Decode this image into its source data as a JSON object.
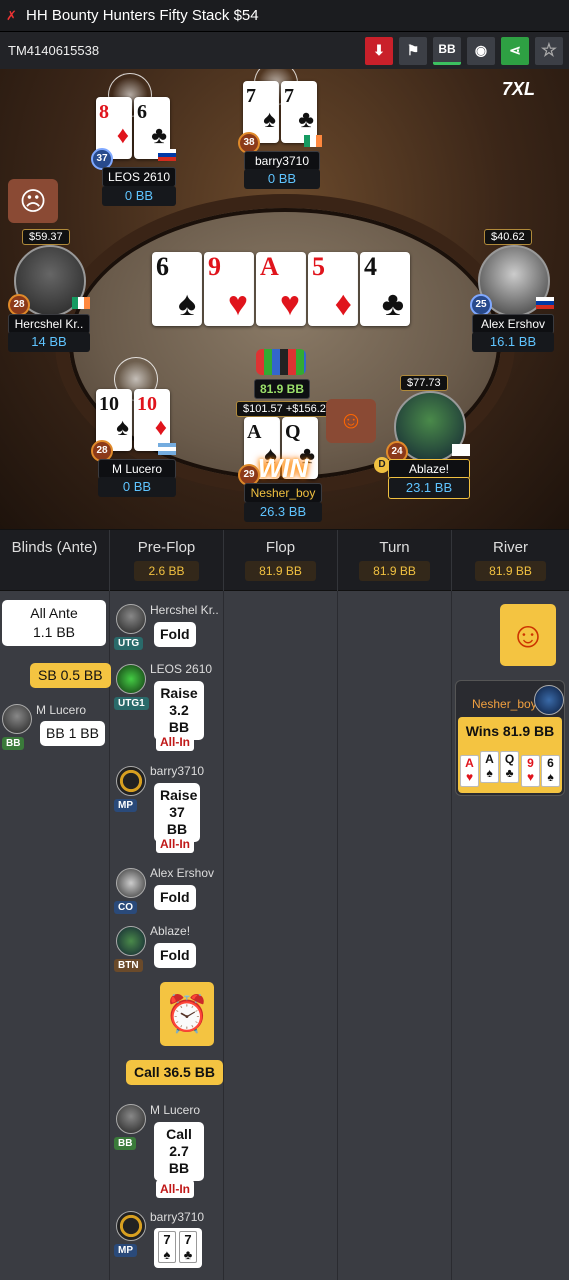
{
  "title": "HH  Bounty Hunters Fifty Stack $54",
  "hand_id": "TM4140615538",
  "toolbar": {
    "bb_label": "BB"
  },
  "board": [
    {
      "rank": "6",
      "suit": "♠",
      "color": "black"
    },
    {
      "rank": "9",
      "suit": "♥",
      "color": "red"
    },
    {
      "rank": "A",
      "suit": "♥",
      "color": "red"
    },
    {
      "rank": "5",
      "suit": "♦",
      "color": "red"
    },
    {
      "rank": "4",
      "suit": "♣",
      "color": "black"
    }
  ],
  "pot": "81.9 BB",
  "logo": "7XL",
  "seats": {
    "leos": {
      "name": "LEOS 2610",
      "bb": "0 BB",
      "level": "37",
      "cards": [
        {
          "rank": "8",
          "suit": "♦",
          "color": "red"
        },
        {
          "rank": "6",
          "suit": "♣",
          "color": "black"
        }
      ]
    },
    "barry": {
      "name": "barry3710",
      "bb": "0 BB",
      "level": "38",
      "cards": [
        {
          "rank": "7",
          "suit": "♠",
          "color": "black"
        },
        {
          "rank": "7",
          "suit": "♣",
          "color": "black"
        }
      ]
    },
    "hercshel": {
      "name": "Hercshel Kr..",
      "bb": "14 BB",
      "level": "28",
      "bounty": "$59.37"
    },
    "alex": {
      "name": "Alex Ershov",
      "bb": "16.1 BB",
      "level": "25",
      "bounty": "$40.62"
    },
    "lucero": {
      "name": "M Lucero",
      "bb": "0 BB",
      "level": "28",
      "cards": [
        {
          "rank": "10",
          "suit": "♠",
          "color": "black"
        },
        {
          "rank": "10",
          "suit": "♦",
          "color": "red"
        }
      ]
    },
    "nesher": {
      "name": "Nesher_boy",
      "bb": "26.3 BB",
      "level": "29",
      "win_label": "WIN",
      "bounty": "$101.57 +$156.26",
      "cards": [
        {
          "rank": "A",
          "suit": "♠",
          "color": "black"
        },
        {
          "rank": "Q",
          "suit": "♣",
          "color": "black"
        }
      ]
    },
    "ablaze": {
      "name": "Ablaze!",
      "bb": "23.1 BB",
      "level": "24",
      "bounty": "$77.73",
      "dealer": "D"
    }
  },
  "streets": [
    {
      "label": "Blinds (Ante)",
      "value": ""
    },
    {
      "label": "Pre-Flop",
      "value": "2.6 BB"
    },
    {
      "label": "Flop",
      "value": "81.9 BB"
    },
    {
      "label": "Turn",
      "value": "81.9 BB"
    },
    {
      "label": "River",
      "value": "81.9 BB"
    }
  ],
  "blinds": {
    "ante_title": "All Ante",
    "ante_value": "1.1 BB",
    "sb": "SB 0.5 BB",
    "bb_player": "M Lucero",
    "bb_pos": "BB",
    "bb_action": "BB 1 BB"
  },
  "preflop": [
    {
      "player": "Hercshel Kr..",
      "pos": "UTG",
      "action": "Fold",
      "allin": ""
    },
    {
      "player": "LEOS 2610",
      "pos": "UTG1",
      "action": "Raise\n3.2 BB",
      "allin": "All-In"
    },
    {
      "player": "barry3710",
      "pos": "MP",
      "action": "Raise\n37 BB",
      "allin": "All-In"
    },
    {
      "player": "Alex Ershov",
      "pos": "CO",
      "action": "Fold",
      "allin": ""
    },
    {
      "player": "Ablaze!",
      "pos": "BTN",
      "action": "Fold",
      "allin": ""
    }
  ],
  "call_action": "Call 36.5 BB",
  "preflop2": [
    {
      "player": "M Lucero",
      "pos": "BB",
      "action": "Call\n2.7 BB",
      "allin": "All-In"
    },
    {
      "player": "barry3710",
      "pos": "MP",
      "cards": [
        {
          "rank": "7",
          "suit": "♠"
        },
        {
          "rank": "7",
          "suit": "♣"
        }
      ]
    }
  ],
  "river": {
    "player": "Nesher_boy",
    "result": "Wins 81.9 BB",
    "cards": [
      {
        "rank": "A",
        "suit": "♥",
        "color": "red"
      },
      {
        "rank": "A",
        "suit": "♠",
        "color": "black"
      },
      {
        "rank": "Q",
        "suit": "♣",
        "color": "black"
      },
      {
        "rank": "9",
        "suit": "♥",
        "color": "red"
      },
      {
        "rank": "6",
        "suit": "♠",
        "color": "black"
      }
    ]
  }
}
